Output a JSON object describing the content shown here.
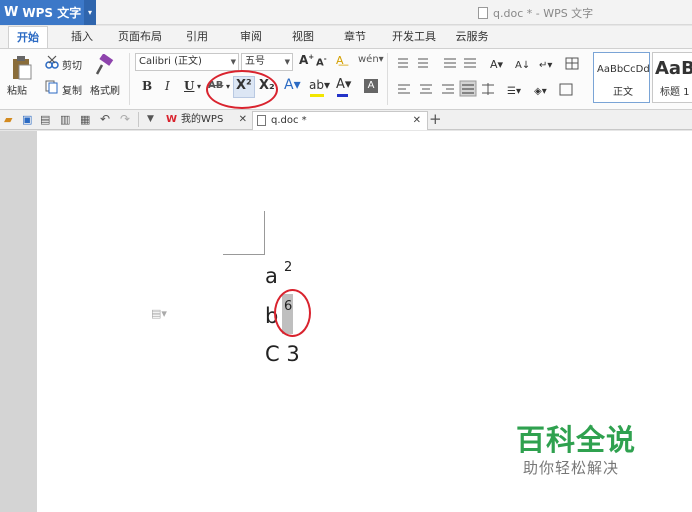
{
  "app": {
    "button_label": "WPS 文字",
    "window_title": "q.doc * - WPS 文字"
  },
  "menu": {
    "tabs": [
      "开始",
      "插入",
      "页面布局",
      "引用",
      "审阅",
      "视图",
      "章节",
      "开发工具",
      "云服务"
    ]
  },
  "ribbon": {
    "paste_label": "粘贴",
    "cut_label": "剪切",
    "copy_label": "复制",
    "format_painter_label": "格式刷",
    "font_name": "Calibri (正文)",
    "font_size": "五号",
    "bold": "B",
    "italic": "I",
    "underline": "U",
    "strikethrough": "AB",
    "superscript": "X²",
    "subscript": "X₂",
    "style_normal_preview": "AaBbCcDd",
    "style_normal_label": "正文",
    "style_heading_preview": "AaB",
    "style_heading_label": "标题 1"
  },
  "tabstrip": {
    "home_tab": "我的WPS",
    "doc_tab": "q.doc *"
  },
  "document": {
    "lines": [
      {
        "base": "a",
        "sup": "2"
      },
      {
        "base": "b",
        "sup": "6"
      },
      {
        "text": "C 3"
      }
    ]
  },
  "watermark": {
    "title": "百科全说",
    "subtitle": "助你轻松解决"
  },
  "colors": {
    "accent": "#3c78c8",
    "annotation": "#d9232e",
    "watermark": "#2fa14f"
  }
}
